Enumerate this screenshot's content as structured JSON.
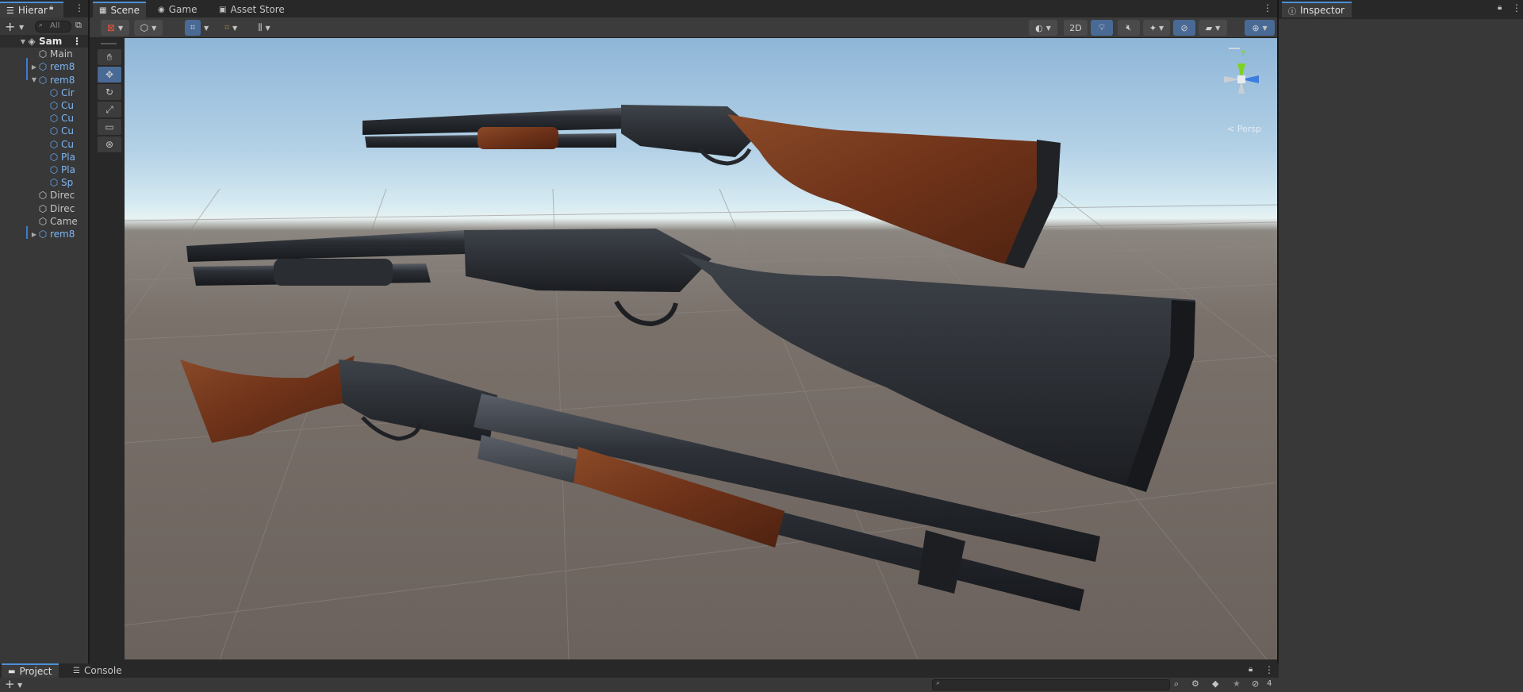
{
  "hierarchy": {
    "tab_label": "Hierar",
    "search_placeholder": "All",
    "add_label": "+",
    "rows": [
      {
        "label": "Sam",
        "depth": 0,
        "kind": "scene",
        "fold": "▼"
      },
      {
        "label": "Main",
        "depth": 1,
        "kind": "object",
        "fold": ""
      },
      {
        "label": "rem8",
        "depth": 1,
        "kind": "prefab",
        "fold": "▶"
      },
      {
        "label": "rem8",
        "depth": 1,
        "kind": "prefab",
        "fold": "▼"
      },
      {
        "label": "Cir",
        "depth": 2,
        "kind": "prefab",
        "fold": ""
      },
      {
        "label": "Cu",
        "depth": 2,
        "kind": "prefab",
        "fold": ""
      },
      {
        "label": "Cu",
        "depth": 2,
        "kind": "prefab",
        "fold": ""
      },
      {
        "label": "Cu",
        "depth": 2,
        "kind": "prefab",
        "fold": ""
      },
      {
        "label": "Cu",
        "depth": 2,
        "kind": "prefab",
        "fold": ""
      },
      {
        "label": "Pla",
        "depth": 2,
        "kind": "prefab",
        "fold": ""
      },
      {
        "label": "Pla",
        "depth": 2,
        "kind": "prefab",
        "fold": ""
      },
      {
        "label": "Sp",
        "depth": 2,
        "kind": "prefab",
        "fold": ""
      },
      {
        "label": "Direc",
        "depth": 1,
        "kind": "object",
        "fold": ""
      },
      {
        "label": "Direc",
        "depth": 1,
        "kind": "object",
        "fold": ""
      },
      {
        "label": "Came",
        "depth": 1,
        "kind": "object",
        "fold": ""
      },
      {
        "label": "rem8",
        "depth": 1,
        "kind": "prefab",
        "fold": "▶"
      }
    ]
  },
  "scene_tabs": [
    {
      "label": "Scene",
      "icon": "scene-icon",
      "active": true
    },
    {
      "label": "Game",
      "icon": "game-controller-icon",
      "active": false
    },
    {
      "label": "Asset Store",
      "icon": "shopping-bag-icon",
      "active": false
    }
  ],
  "scene_toolbar": {
    "mode_2d_label": "2D",
    "gizmo_persp_label": "< Persp",
    "axis_labels": {
      "y": "y",
      "x": "x",
      "z": "z"
    }
  },
  "tools": [
    "hand-tool",
    "move-tool",
    "rotate-tool",
    "scale-tool",
    "rect-tool",
    "transform-tool"
  ],
  "inspector": {
    "tab_label": "Inspector"
  },
  "bottom": {
    "tabs": [
      {
        "label": "Project",
        "icon": "folder-icon",
        "active": true
      },
      {
        "label": "Console",
        "icon": "console-icon",
        "active": false
      }
    ],
    "add_label": "+",
    "hidden_count": "4"
  },
  "colors": {
    "accent": "#4d90d9",
    "prefab_text": "#7db6f5",
    "wood": "#7a3c1f",
    "gunmetal": "#2a2d33"
  }
}
